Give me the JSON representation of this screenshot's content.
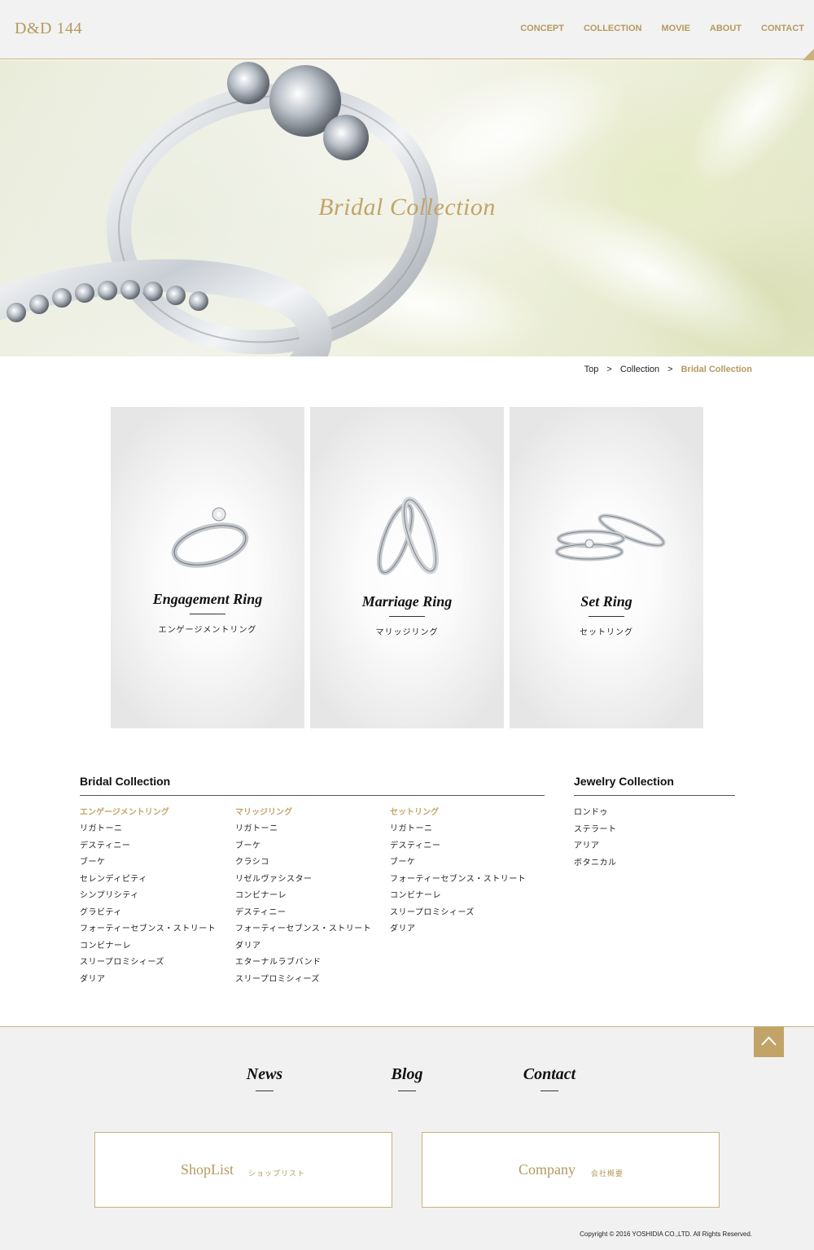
{
  "header": {
    "logo": "D&D 144",
    "nav": [
      "CONCEPT",
      "COLLECTION",
      "MOVIE",
      "ABOUT",
      "CONTACT"
    ]
  },
  "hero": {
    "title": "Bridal Collection"
  },
  "breadcrumb": {
    "items": [
      "Top",
      "Collection",
      "Bridal Collection"
    ],
    "separator": ">"
  },
  "cards": [
    {
      "title": "Engagement Ring",
      "subtitle": "エンゲージメントリング"
    },
    {
      "title": "Marriage Ring",
      "subtitle": "マリッジリング"
    },
    {
      "title": "Set Ring",
      "subtitle": "セットリング"
    }
  ],
  "sitemap": {
    "bridal_heading": "Bridal Collection",
    "jewelry_heading": "Jewelry Collection",
    "columns": [
      {
        "title": "エンゲージメントリング",
        "items": [
          "リガトーニ",
          "デスティニー",
          "ブーケ",
          "セレンディピティ",
          "シンプリシティ",
          "グラビティ",
          "フォーティーセブンス・ストリート",
          "コンビナーレ",
          "スリープロミシィーズ",
          "ダリア"
        ]
      },
      {
        "title": "マリッジリング",
        "items": [
          "リガトーニ",
          "ブーケ",
          "クラシコ",
          "リゼルヴァシスター",
          "コンビナーレ",
          "デスティニー",
          "フォーティーセブンス・ストリート",
          "ダリア",
          "エターナルラブバンド",
          "スリープロミシィーズ"
        ]
      },
      {
        "title": "セットリング",
        "items": [
          "リガトーニ",
          "デスティニー",
          "ブーケ",
          "フォーティーセブンス・ストリート",
          "コンビナーレ",
          "スリープロミシィーズ",
          "ダリア"
        ]
      }
    ],
    "jewelry_items": [
      "ロンドゥ",
      "ステラート",
      "アリア",
      "ボタニカル"
    ]
  },
  "footer": {
    "links": [
      "News",
      "Blog",
      "Contact"
    ],
    "boxes": [
      {
        "en": "ShopList",
        "jp": "ショップリスト"
      },
      {
        "en": "Company",
        "jp": "会社概要"
      }
    ],
    "copyright": "Copyright © 2016 YOSHIDIA CO.,LTD. All Rights Reserved."
  },
  "colors": {
    "accent": "#b59a5e",
    "header_bg": "#f2f2f2",
    "footer_bg": "#f1f1f1"
  },
  "icons": {
    "to_top": "chevron-up-icon"
  }
}
